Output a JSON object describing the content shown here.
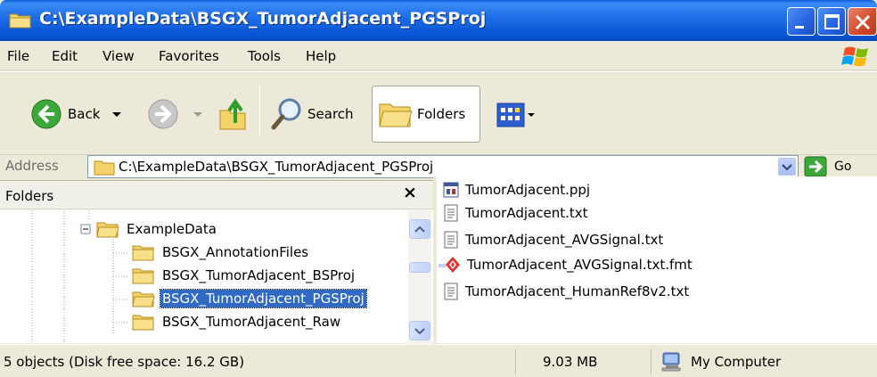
{
  "window": {
    "title": "C:\\ExampleData\\BSGX_TumorAdjacent_PGSProj"
  },
  "menu": {
    "items": [
      "File",
      "Edit",
      "View",
      "Favorites",
      "Tools",
      "Help"
    ]
  },
  "toolbar": {
    "back_label": "Back",
    "search_label": "Search",
    "folders_label": "Folders"
  },
  "address": {
    "label": "Address",
    "value": "C:\\ExampleData\\BSGX_TumorAdjacent_PGSProj",
    "go_label": "Go"
  },
  "folders_pane": {
    "title": "Folders",
    "close_glyph": "×",
    "tree": [
      {
        "label": "ExampleData",
        "expanded": true
      },
      {
        "label": "BSGX_AnnotationFiles"
      },
      {
        "label": "BSGX_TumorAdjacent_BSProj"
      },
      {
        "label": "BSGX_TumorAdjacent_PGSProj",
        "selected": true
      },
      {
        "label": "BSGX_TumorAdjacent_Raw"
      }
    ]
  },
  "files": [
    {
      "name": "TumorAdjacent.ppj",
      "icon": "ppj-file-icon"
    },
    {
      "name": "TumorAdjacent.txt",
      "icon": "text-file-icon"
    },
    {
      "name": "TumorAdjacent_AVGSignal.txt",
      "icon": "text-file-icon"
    },
    {
      "name": "TumorAdjacent_AVGSignal.txt.fmt",
      "icon": "fmt-file-icon"
    },
    {
      "name": "TumorAdjacent_HumanRef8v2.txt",
      "icon": "text-file-icon"
    }
  ],
  "status": {
    "summary": "5 objects (Disk free space: 16.2 GB)",
    "size": "9.03 MB",
    "zone": "My Computer"
  },
  "colors": {
    "titlebar": "#0855D4",
    "selection": "#316AC5",
    "chrome": "#ECE9D8"
  }
}
